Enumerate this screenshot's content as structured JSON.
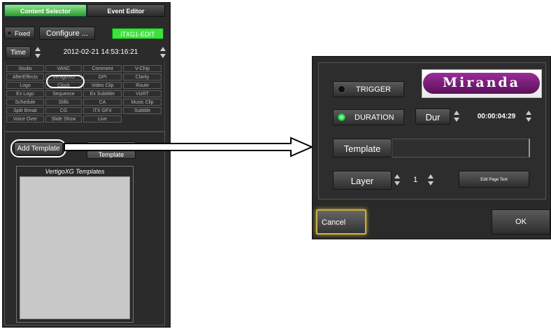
{
  "left_panel": {
    "tabs": [
      "Content Selector",
      "Event Editor"
    ],
    "fixed_label": "Fixed",
    "configure_label": "Configure ...",
    "status_label": "iTXG1-EDIT",
    "time_label": "Time",
    "time_value": "2012-02-21 14:53:16:21",
    "grid_rows": [
      [
        "Studio",
        "VANC",
        "Comment",
        "V-Chip"
      ],
      [
        "AfterEffects",
        "VertigoXG",
        "GPI",
        "Clarity"
      ],
      [
        "Logo",
        "Clock",
        "Video Clip",
        "Route"
      ],
      [
        "Ex Logo",
        "Sequence",
        "Ex Subtitler",
        "VizRT"
      ],
      [
        "Schedule",
        "Stills",
        "CA",
        "Music Clip"
      ],
      [
        "Split Break",
        "CG",
        "iTX GFX",
        "Subtitle"
      ],
      [
        "Voice Over",
        "Slide Show",
        "Live"
      ]
    ],
    "add_template_label": "Add Template",
    "delete_template_label": "Delete\nTemplate",
    "templates_title": "VertigoXG Templates"
  },
  "right_panel": {
    "trigger_label": "TRIGGER",
    "logo_text": "Miranda",
    "duration_label": "DURATION",
    "dur_label": "Dur",
    "dur_value": "00:00:04:29",
    "template_label": "Template",
    "template_value": "",
    "layer_label": "Layer",
    "layer_value": "1",
    "edit_page_label": "Edit Page Text",
    "cancel_label": "Cancel",
    "ok_label": "OK"
  },
  "colors": {
    "active_tab": "#3ca83c",
    "status_green": "#3ce23c",
    "logo_purple": "#7a1f7a",
    "cancel_border": "#c8b040"
  }
}
